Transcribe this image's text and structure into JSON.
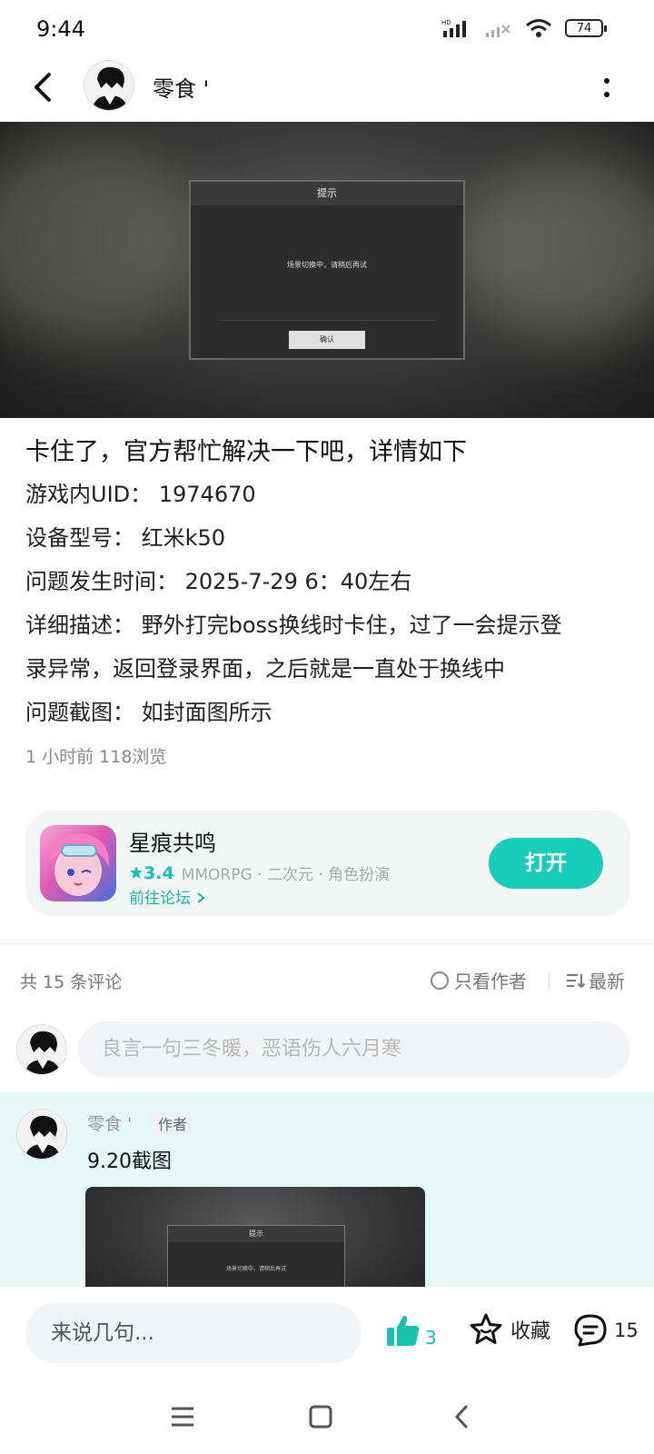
{
  "status_bar": {
    "time": "9:44",
    "battery": "74",
    "hd_label": "HD"
  },
  "header": {
    "username": "零食 '"
  },
  "cover": {
    "dialog_title": "提示",
    "dialog_message": "场景切换中，请稍后再试",
    "dialog_button": "确认"
  },
  "post": {
    "title": "卡住了，官方帮忙解决一下吧，详情如下",
    "lines": [
      "游戏内UID：  1974670",
      "设备型号：  红米k50",
      "问题发生时间：  2025-7-29 6：40左右",
      "详细描述：  野外打完boss换线时卡住，过了一会提示登",
      "录异常，返回登录界面，之后就是一直处于换线中",
      "问题截图：  如封面图所示"
    ],
    "meta": "1 小时前  118浏览"
  },
  "game_card": {
    "name": "星痕共鸣",
    "rating": "3.4",
    "tags": "MMORPG · 二次元 · 角色扮演",
    "forum_link": "前往论坛",
    "open_button": "打开"
  },
  "comments_header": {
    "count": "共 15 条评论",
    "author_only": "只看作者",
    "sort": "最新"
  },
  "comment_input": {
    "placeholder": "良言一句三冬暖，恶语伤人六月寒"
  },
  "comment": {
    "username": "零食 '",
    "tag": "作者",
    "text": "9.20截图",
    "image_dialog_title": "提示",
    "image_dialog_message": "场景切换中，请稍后再试"
  },
  "bottom_bar": {
    "input_placeholder": "来说几句...",
    "like_count": "3",
    "favorite_label": "收藏",
    "comment_count": "15"
  },
  "colors": {
    "accent": "#17cdb9",
    "highlight_bg": "#e6f7f6"
  }
}
